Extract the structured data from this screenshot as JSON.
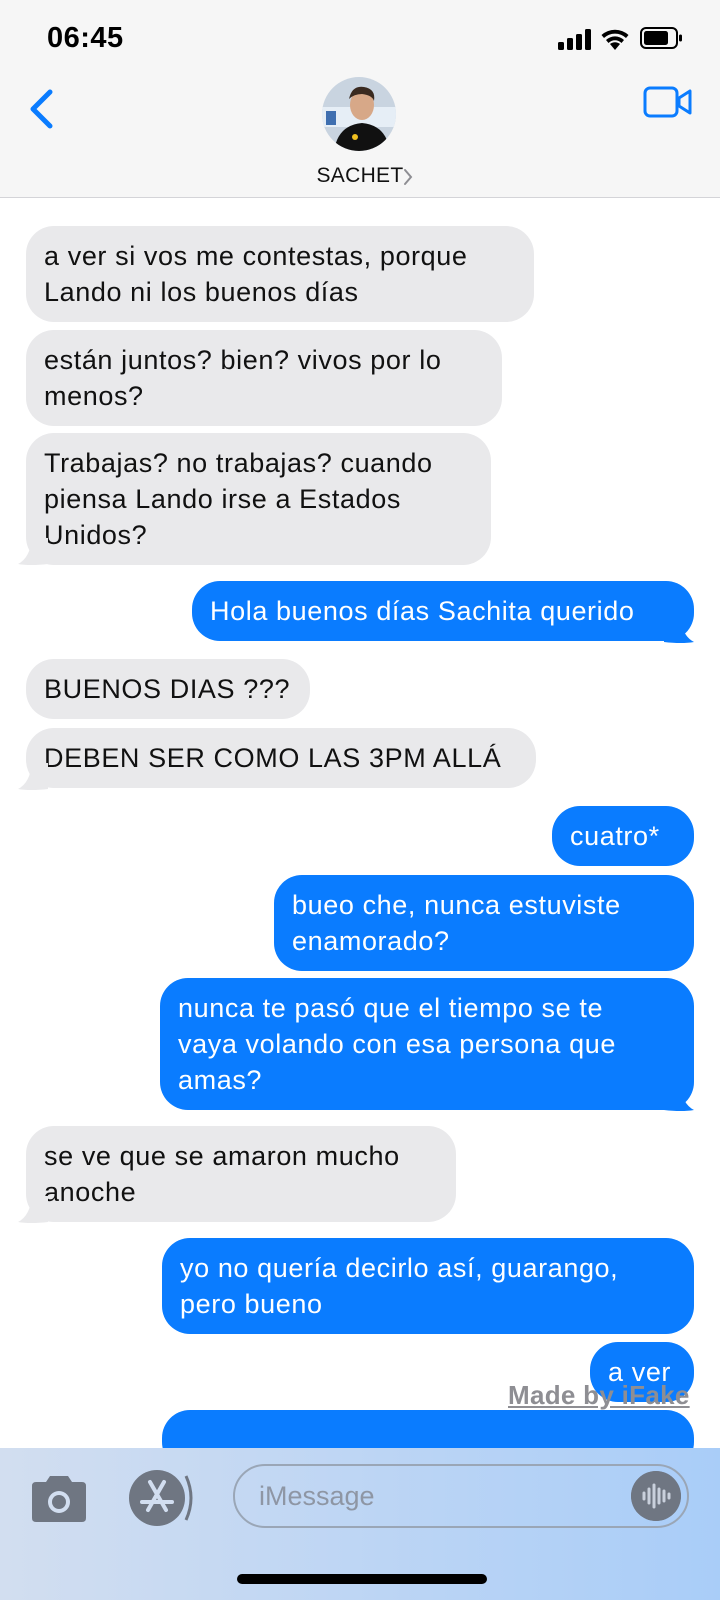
{
  "status_bar": {
    "time": "06:45"
  },
  "header": {
    "contact_name": "SACHET",
    "chevron": "chevron-right-icon"
  },
  "messages": [
    {
      "dir": "in",
      "text": "a ver si vos me contestas, porque\nLando ni los buenos días"
    },
    {
      "dir": "in",
      "text": "están juntos? bien? vivos por lo\nmenos?"
    },
    {
      "dir": "in",
      "text": "Trabajas? no trabajas? cuando\npiensa Lando irse a Estados\nUnidos?"
    },
    {
      "dir": "out",
      "text": "Hola buenos días Sachita querido"
    },
    {
      "dir": "in",
      "text": "BUENOS DIAS ???"
    },
    {
      "dir": "in",
      "text": "DEBEN SER COMO LAS 3PM ALLÁ"
    },
    {
      "dir": "out",
      "text": "cuatro*"
    },
    {
      "dir": "out",
      "text": "bueo che, nunca estuviste\nenamorado?"
    },
    {
      "dir": "out",
      "text": "nunca te pasó que el tiempo se te\nvaya volando con esa persona que\namas?"
    },
    {
      "dir": "in",
      "text": "se ve que se amaron mucho\nanoche"
    },
    {
      "dir": "out",
      "text": "yo no quería decirlo así, guarango,\npero bueno"
    },
    {
      "dir": "out",
      "text": "a ver"
    }
  ],
  "watermark": "Made by iFake",
  "input": {
    "placeholder": "iMessage"
  },
  "colors": {
    "outgoing": "#0a7cff",
    "incoming": "#e9e9eb",
    "accent": "#0a7cff"
  }
}
